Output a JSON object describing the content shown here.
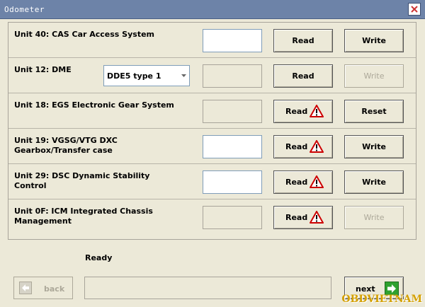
{
  "window": {
    "title": "Odometer"
  },
  "rows": [
    {
      "label": "Unit 40: CAS Car Access System",
      "field_enabled": true,
      "read_label": "Read",
      "read_warning": false,
      "action_label": "Write",
      "action_enabled": true
    },
    {
      "label": "Unit 12: DME",
      "combo": {
        "value": "DDE5 type 1"
      },
      "field_enabled": false,
      "read_label": "Read",
      "read_warning": false,
      "action_label": "Write",
      "action_enabled": false
    },
    {
      "label": "Unit 18: EGS Electronic Gear System",
      "field_enabled": false,
      "read_label": "Read",
      "read_warning": true,
      "action_label": "Reset",
      "action_enabled": true
    },
    {
      "label": "Unit 19: VGSG/VTG DXC Gearbox/Transfer case",
      "field_enabled": true,
      "read_label": "Read",
      "read_warning": true,
      "action_label": "Write",
      "action_enabled": true
    },
    {
      "label": "Unit 29: DSC Dynamic Stability Control",
      "field_enabled": true,
      "read_label": "Read",
      "read_warning": true,
      "action_label": "Write",
      "action_enabled": true
    },
    {
      "label": "Unit 0F: ICM Integrated Chassis Management",
      "field_enabled": false,
      "read_label": "Read",
      "read_warning": true,
      "action_label": "Write",
      "action_enabled": false
    }
  ],
  "status": {
    "text": "Ready"
  },
  "nav": {
    "back_label": "back",
    "next_label": "next"
  },
  "watermark": "OBDVIETNAM",
  "colors": {
    "titlebar": "#6d83a8",
    "warning": "#cc0000",
    "next_arrow": "#2fa12f"
  }
}
